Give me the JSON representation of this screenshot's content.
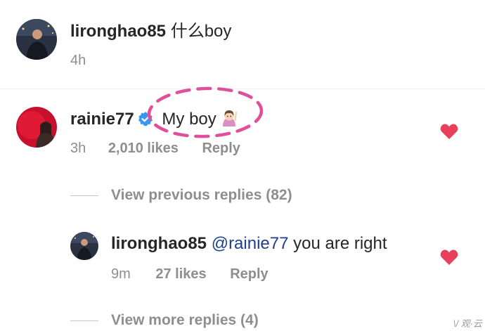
{
  "comment1": {
    "username": "lironghao85",
    "text": "什么boy",
    "time": "4h"
  },
  "comment2": {
    "username": "rainie77",
    "text": "My boy",
    "time": "3h",
    "likes": "2,010 likes",
    "reply": "Reply",
    "verified_icon": "verified-badge-icon",
    "emoji": "woman-raising-hand-emoji"
  },
  "view_previous": "View previous replies (82)",
  "reply1": {
    "username": "lironghao85",
    "mention": "@rainie77",
    "text": "you are right",
    "time": "9m",
    "likes": "27 likes",
    "reply": "Reply"
  },
  "view_more": "View more replies (4)",
  "watermark": "\\/ 观·云",
  "colors": {
    "heart": "#e8405a",
    "highlight": "#e0509a",
    "verified": "#3897f0",
    "mention": "#1d3f8f"
  }
}
